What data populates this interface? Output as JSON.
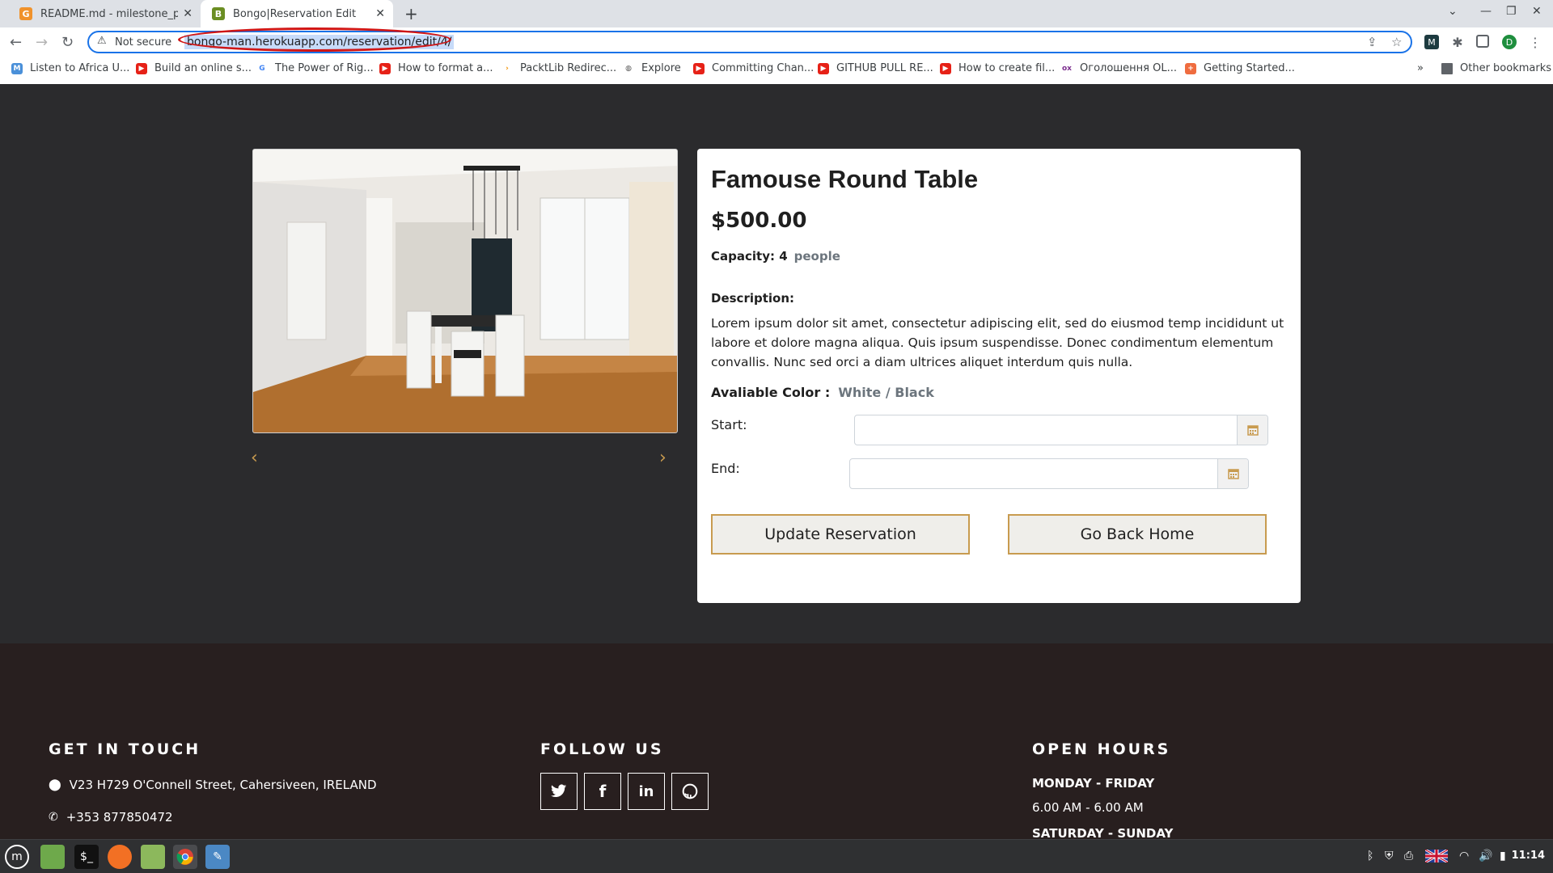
{
  "browser": {
    "tabs": [
      {
        "title": "README.md - milestone_proj",
        "favicon": "gitpod-icon"
      },
      {
        "title": "Bongo|Reservation Edit",
        "favicon": "bongo-icon"
      }
    ],
    "security_label": "Not secure",
    "url": "bongo-man.herokuapp.com/reservation/edit/4/",
    "bookmarks": [
      "Listen to Africa U...",
      "Build an online s...",
      "The Power of Rig...",
      "How to format a...",
      "PacktLib Redirec...",
      "Explore",
      "Committing Chan...",
      "GITHUB PULL RE...",
      "How to create fil...",
      "Оголошення OL...",
      "Getting Started..."
    ],
    "other_bookmarks": "Other bookmarks",
    "profile_initial": "D"
  },
  "carousel": {
    "image_alt": "dining-room-photo",
    "prev_icon": "chevron-left-icon",
    "next_icon": "chevron-right-icon"
  },
  "product": {
    "title": "Famouse Round Table",
    "price": "$500.00",
    "capacity_label": "Capacity: 4",
    "capacity_unit": "people",
    "description_label": "Description:",
    "description": "Lorem ipsum dolor sit amet, consectetur adipiscing elit, sed do eiusmod temp incididunt ut labore et dolore magna aliqua. Quis ipsum suspendisse. Donec condimentum elementum convallis. Nunc sed orci a diam ultrices aliquet interdum quis nulla.",
    "color_label": "Avaliable Color :",
    "color_value": "White / Black"
  },
  "form": {
    "start_label": "Start:",
    "start_value": "",
    "end_label": "End:",
    "end_value": "",
    "update_button": "Update Reservation",
    "home_button": "Go Back Home"
  },
  "footer": {
    "contact_heading": "GET IN TOUCH",
    "address": "V23 H729 O'Connell Street, Cahersiveen, IRELAND",
    "phone": "+353 877850472",
    "follow_heading": "FOLLOW US",
    "social": [
      "twitter-icon",
      "facebook-icon",
      "linkedin-icon",
      "github-icon"
    ],
    "hours_heading": "OPEN HOURS",
    "weekday_label": "MONDAY - FRIDAY",
    "weekday_hours": "6.00 AM - 6.00 AM",
    "weekend_label": "SATURDAY - SUNDAY"
  },
  "taskbar": {
    "clock": "11:14"
  },
  "colors": {
    "accent": "#c89b4f",
    "hero_bg": "#2b2b2d",
    "footer_bg": "#281f1f"
  }
}
